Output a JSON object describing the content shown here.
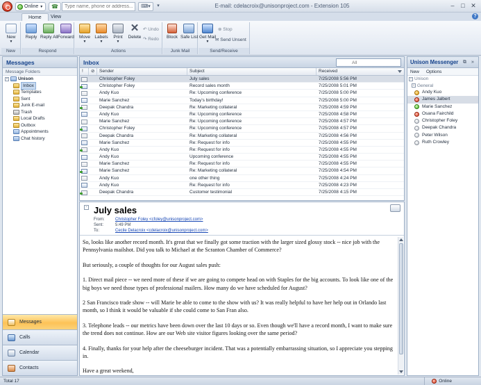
{
  "titlebar": {
    "status_label": "Online",
    "dial_placeholder": "Type name, phone or address...",
    "window_title": "E-mail: cdelacroix@unisonproject.com - Extension 105"
  },
  "ribbon": {
    "tabs": [
      "Home",
      "View"
    ],
    "groups": {
      "new": {
        "label": "New",
        "buttons": {
          "new": "New"
        }
      },
      "respond": {
        "label": "Respond",
        "buttons": {
          "reply": "Reply",
          "reply_all": "Reply All",
          "forward": "Forward"
        }
      },
      "actions": {
        "label": "Actions",
        "buttons": {
          "move": "Move",
          "labels": "Labels",
          "print": "Print",
          "delete": "Delete",
          "undo": "Undo",
          "redo": "Redo"
        }
      },
      "junk": {
        "label": "Junk Mail",
        "buttons": {
          "block": "Block",
          "safe_list": "Safe List"
        }
      },
      "send_receive": {
        "label": "Send/Receive",
        "buttons": {
          "get_mail": "Get Mail",
          "stop": "Stop",
          "send_unsent": "Send Unsent"
        }
      }
    }
  },
  "left": {
    "title": "Messages",
    "folders_header": "Message Folders",
    "root": "Unison",
    "folders": [
      "Inbox",
      "Templates",
      "Sent",
      "Junk E-mail",
      "Trash",
      "Local Drafts",
      "Outbox",
      "Appointments",
      "Chat history"
    ],
    "nav": [
      "Messages",
      "Calls",
      "Calendar",
      "Contacts"
    ]
  },
  "inbox": {
    "title": "Inbox",
    "search_placeholder": "All",
    "columns": {
      "sender": "Sender",
      "subject": "Subject",
      "received": "Received"
    },
    "rows": [
      {
        "sender": "Christopher Foley",
        "subject": "July sales",
        "received": "7/25/2008 5:56 PM"
      },
      {
        "sender": "Christopher Foley",
        "subject": "Record sales month",
        "received": "7/25/2008 5:01 PM"
      },
      {
        "sender": "Andy Kuo",
        "subject": "Re: Upcoming conference",
        "received": "7/25/2008 5:00 PM"
      },
      {
        "sender": "Marie Sanchez",
        "subject": "Today's birthday!",
        "received": "7/25/2008 5:00 PM"
      },
      {
        "sender": "Deepak Chandra",
        "subject": "Re: Marketing collateral",
        "received": "7/25/2008 4:59 PM"
      },
      {
        "sender": "Andy Kuo",
        "subject": "Re: Upcoming conference",
        "received": "7/25/2008 4:58 PM"
      },
      {
        "sender": "Marie Sanchez",
        "subject": "Re: Upcoming conference",
        "received": "7/25/2008 4:57 PM"
      },
      {
        "sender": "Christopher Foley",
        "subject": "Re: Upcoming conference",
        "received": "7/25/2008 4:57 PM"
      },
      {
        "sender": "Deepak Chandra",
        "subject": "Re: Marketing collateral",
        "received": "7/25/2008 4:56 PM"
      },
      {
        "sender": "Marie Sanchez",
        "subject": "Re: Request for info",
        "received": "7/25/2008 4:55 PM"
      },
      {
        "sender": "Andy Kuo",
        "subject": "Re: Request for info",
        "received": "7/25/2008 4:55 PM"
      },
      {
        "sender": "Andy Kuo",
        "subject": "Upcoming conference",
        "received": "7/25/2008 4:55 PM"
      },
      {
        "sender": "Marie Sanchez",
        "subject": "Re: Request for info",
        "received": "7/25/2008 4:55 PM"
      },
      {
        "sender": "Marie Sanchez",
        "subject": "Re: Marketing collateral",
        "received": "7/25/2008 4:54 PM"
      },
      {
        "sender": "Andy Kuo",
        "subject": "one other thing",
        "received": "7/25/2008 4:24 PM"
      },
      {
        "sender": "Andy Kuo",
        "subject": "Re: Request for info",
        "received": "7/25/2008 4:23 PM"
      },
      {
        "sender": "Deepak Chandra",
        "subject": "Customer testimonial",
        "received": "7/25/2008 4:15 PM"
      }
    ]
  },
  "reading": {
    "subject": "July sales",
    "from_label": "From:",
    "from": "Christopher Foley <cfoley@unisonproject.com>",
    "sent_label": "Sent:",
    "sent": "5:49 PM",
    "to_label": "To:",
    "to": "Cecile Delacroix <cdelacroix@unisonproject.com>",
    "body": [
      "So, looks like another record month. It's great that we finally got some traction with the larger sized glossy stock -- nice job with the Pennsylvania mailshot. Did you talk to Michael at the Scranton Chamber of Commerce?",
      "But seriously, a couple of thoughts for our August sales push:",
      "1. Direct mail piece -- we need more of these if we are going to compete head on with Staples for the big accounts. To look like one of the big boys we need those types of professional mailers. How many do we have scheduled for August?",
      "2 San Francisco trade show -- will Marie be able to come to the show with us? It was really helpful to have her help out in Orlando last month, so I think it would be valuable if she could come to San Fran also.",
      "3.  Telephone leads -- our metrics have been down over the last 10 days or so. Even though we'll have a record month, I want to make sure the trend does not continue. How are our Web site visitor figures looking over the same period?",
      "4. Finally, thanks for your help after the cheeseburger incident. That was a potentially embarrassing situation, so I appreciate you stepping in.",
      "Have a great weekend,"
    ]
  },
  "messenger": {
    "title": "Unison Messenger",
    "menu": [
      "New",
      "Options"
    ],
    "group_root": "Unison",
    "group_sub": "General",
    "contacts": [
      {
        "name": "Andy Kuo",
        "presence": "away"
      },
      {
        "name": "James Jalbert",
        "presence": "busy"
      },
      {
        "name": "Marie Sanchez",
        "presence": "available"
      },
      {
        "name": "Osana Fairchild",
        "presence": "busy"
      },
      {
        "name": "Christopher Foley",
        "presence": "offline"
      },
      {
        "name": "Deepak Chandra",
        "presence": "offline"
      },
      {
        "name": "Peter Wilson",
        "presence": "offline"
      },
      {
        "name": "Ruth Crowley",
        "presence": "offline"
      }
    ]
  },
  "statusbar": {
    "total": "Total 17",
    "online": "Online"
  }
}
